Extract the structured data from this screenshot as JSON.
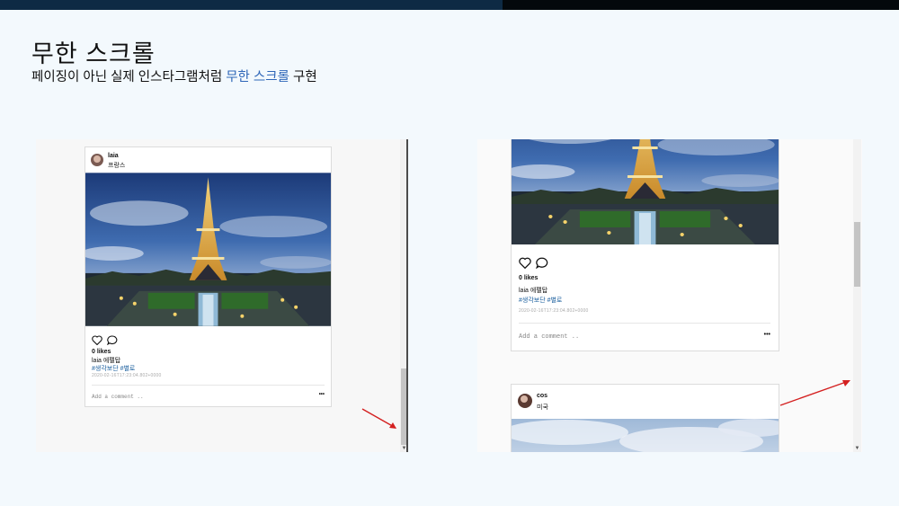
{
  "slide": {
    "title": "무한 스크롤",
    "subtitle_pre": "페이징이 아닌 실제 인스타그램처럼 ",
    "subtitle_highlight": "무한 스크롤",
    "subtitle_post": " 구현"
  },
  "colors": {
    "topbar_left": "#0e2a44",
    "topbar_right": "#04080c",
    "highlight": "#2e66b8",
    "arrow": "#d42020",
    "tag_link": "#1b5f9e"
  },
  "left_panel": {
    "post": {
      "username": "laia",
      "location": "프랑스",
      "likes": "0 likes",
      "caption": "laia 에펠탑",
      "tags": "#생각보단 #별로",
      "date": "2020-02-16T17:23:04.802+0000",
      "comment_placeholder": "Add a comment ..",
      "more": "•••"
    },
    "scroll_position": 0.88
  },
  "right_panel": {
    "post1": {
      "likes": "0 likes",
      "caption": "laia 에펠탑",
      "tags": "#생각보단 #별로",
      "date": "2020-02-16T17:23:04.802+0000",
      "comment_placeholder": "Add a comment ..",
      "more": "•••"
    },
    "post2": {
      "username": "cos",
      "location": "미국"
    },
    "scroll_position": 0.35
  },
  "icons": [
    "heart-icon",
    "comment-icon",
    "avatar",
    "scroll-down-arrow-icon",
    "red-pointer-arrow"
  ]
}
